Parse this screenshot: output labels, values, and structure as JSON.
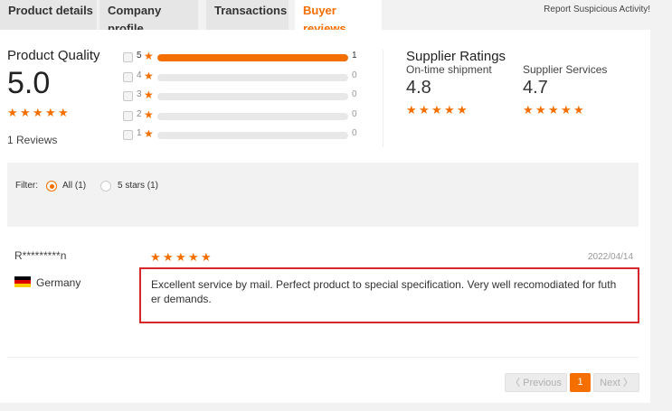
{
  "tabs": [
    {
      "label": "Product details",
      "active": false
    },
    {
      "label": "Company profile",
      "active": false
    },
    {
      "label": "Transactions",
      "active": false
    },
    {
      "label": "Buyer reviews",
      "active": true
    }
  ],
  "report_link": "Report Suspicious Activity!",
  "product_quality": {
    "title": "Product Quality",
    "score": "5.0",
    "stars": 5,
    "reviews_label": "1 Reviews"
  },
  "rating_breakdown": [
    {
      "stars": "5",
      "count": "1",
      "fraction": 1.0
    },
    {
      "stars": "4",
      "count": "0",
      "fraction": 0.0
    },
    {
      "stars": "3",
      "count": "0",
      "fraction": 0.0
    },
    {
      "stars": "2",
      "count": "0",
      "fraction": 0.0
    },
    {
      "stars": "1",
      "count": "0",
      "fraction": 0.0
    }
  ],
  "supplier_ratings": {
    "title": "Supplier Ratings",
    "shipment": {
      "label": "On-time shipment",
      "score": "4.8",
      "stars": 5
    },
    "services": {
      "label": "Supplier Services",
      "score": "4.7",
      "stars": 5
    }
  },
  "filter": {
    "label": "Filter:",
    "options": [
      {
        "label": "All (1)",
        "selected": true
      },
      {
        "label": "5 stars (1)",
        "selected": false
      }
    ]
  },
  "review": {
    "reviewer": "R*********n",
    "country": "Germany",
    "flag_icon": "germany-flag-icon",
    "stars": 5,
    "date": "2022/04/14",
    "text": "Excellent service by mail. Perfect product to special specification. Very well recomodiated for futh er demands."
  },
  "pagination": {
    "previous_label": "〈 Previous",
    "current_page": "1",
    "next_label": "Next 〉"
  },
  "colors": {
    "accent": "#f56e00",
    "highlight_border": "#d6272a"
  }
}
